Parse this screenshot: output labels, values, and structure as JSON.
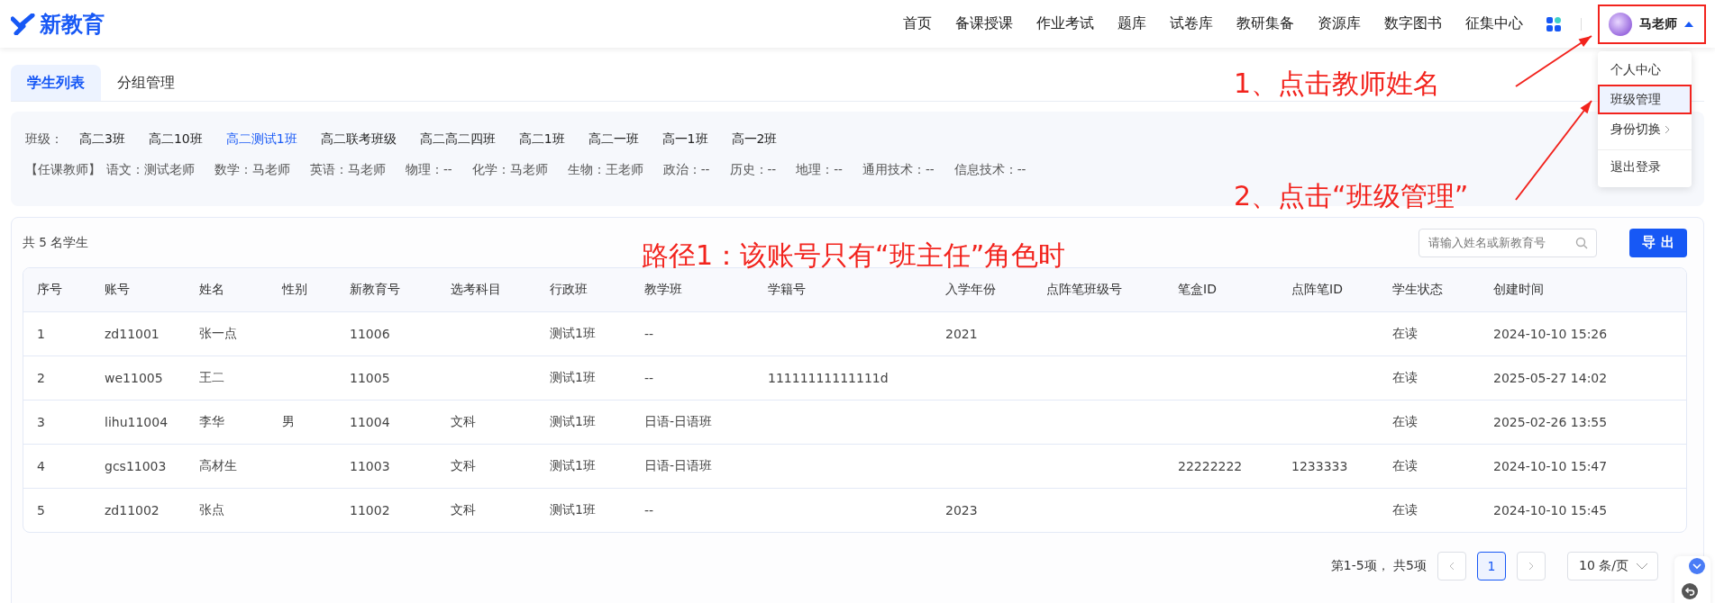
{
  "logo": {
    "text": "新教育"
  },
  "nav": [
    {
      "label": "首页"
    },
    {
      "label": "备课授课"
    },
    {
      "label": "作业考试"
    },
    {
      "label": "题库"
    },
    {
      "label": "试卷库"
    },
    {
      "label": "教研集备"
    },
    {
      "label": "资源库"
    },
    {
      "label": "数字图书"
    },
    {
      "label": "征集中心"
    }
  ],
  "user": {
    "name": "马老师",
    "highlighted": true
  },
  "user_menu": [
    {
      "label": "个人中心",
      "selected": false,
      "highlighted": false,
      "has_submenu": false,
      "divider_before": false
    },
    {
      "label": "班级管理",
      "selected": true,
      "highlighted": true,
      "has_submenu": false,
      "divider_before": false
    },
    {
      "label": "身份切换",
      "selected": false,
      "highlighted": false,
      "has_submenu": true,
      "divider_before": false
    },
    {
      "label": "退出登录",
      "selected": false,
      "highlighted": false,
      "has_submenu": false,
      "divider_before": true
    }
  ],
  "tabs": [
    {
      "label": "学生列表",
      "selected": true
    },
    {
      "label": "分组管理",
      "selected": false
    }
  ],
  "class_filter": {
    "label": "班级：",
    "classes": [
      {
        "label": "高二3班",
        "selected": false
      },
      {
        "label": "高二10班",
        "selected": false
      },
      {
        "label": "高二测试1班",
        "selected": true
      },
      {
        "label": "高二联考班级",
        "selected": false
      },
      {
        "label": "高二高二四班",
        "selected": false
      },
      {
        "label": "高二1班",
        "selected": false
      },
      {
        "label": "高二一班",
        "selected": false
      },
      {
        "label": "高一1班",
        "selected": false
      },
      {
        "label": "高一2班",
        "selected": false
      }
    ]
  },
  "teachers": {
    "label": "【任课教师】",
    "items": [
      "语文：测试老师",
      "数学：马老师",
      "英语：马老师",
      "物理：--",
      "化学：马老师",
      "生物：王老师",
      "政治：--",
      "历史：--",
      "地理：--",
      "通用技术：--",
      "信息技术：--"
    ]
  },
  "student_panel": {
    "count": "共 5 名学生",
    "search": {
      "placeholder": "请输入姓名或新教育号"
    },
    "export_button": "导 出"
  },
  "table": {
    "columns": [
      "序号",
      "账号",
      "姓名",
      "性别",
      "新教育号",
      "选考科目",
      "行政班",
      "教学班",
      "学籍号",
      "入学年份",
      "点阵笔班级号",
      "笔盒ID",
      "点阵笔ID",
      "学生状态",
      "创建时间"
    ],
    "rows": [
      [
        "1",
        "zd11001",
        "张一点",
        null,
        "11006",
        null,
        "测试1班",
        "--",
        null,
        "2021",
        null,
        null,
        null,
        "在读",
        "2024-10-10 15:26"
      ],
      [
        "2",
        "we11005",
        "王二",
        null,
        "11005",
        null,
        "测试1班",
        "--",
        "11111111111111d",
        null,
        null,
        null,
        null,
        "在读",
        "2025-05-27 14:02"
      ],
      [
        "3",
        "lihu11004",
        "李华",
        "男",
        "11004",
        "文科",
        "测试1班",
        "日语-日语班",
        null,
        null,
        null,
        null,
        null,
        "在读",
        "2025-02-26 13:55"
      ],
      [
        "4",
        "gcs11003",
        "高材生",
        null,
        "11003",
        "文科",
        "测试1班",
        "日语-日语班",
        null,
        null,
        null,
        "22222222",
        "1233333",
        "在读",
        "2024-10-10 15:47"
      ],
      [
        "5",
        "zd11002",
        "张点",
        null,
        "11002",
        "文科",
        "测试1班",
        "--",
        null,
        "2023",
        null,
        null,
        null,
        "在读",
        "2024-10-10 15:45"
      ]
    ]
  },
  "pagination": {
    "summary": "第1-5项， 共5项",
    "pages": [
      {
        "label": "1",
        "selected": true
      }
    ],
    "page_size": "10 条/页"
  },
  "annotations": [
    {
      "text": "1、点击教师姓名",
      "kind": "step"
    },
    {
      "text": "2、点击“班级管理”",
      "kind": "step"
    },
    {
      "text": "路径1：该账号只有“班主任”角色时",
      "kind": "note"
    }
  ]
}
